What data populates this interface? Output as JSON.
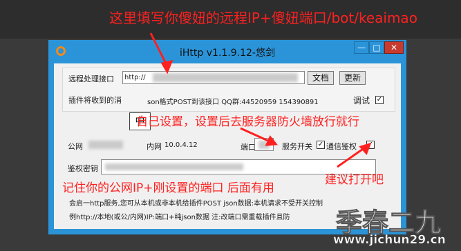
{
  "annotations": {
    "top": "这里填写你傻妞的远程IP+傻妞端口/bot/keaimao",
    "middle": "自己设置，设置后去服务器防火墙放行就行",
    "bottom": "记住你的公网IP+刚设置的端口 后面有用",
    "right": "建议打开吧"
  },
  "window": {
    "title": "iHttp v1.1.9.12-悠剑",
    "min_label": "—",
    "max_label": "□",
    "close_label": "✕"
  },
  "remote": {
    "label": "远程处理接口",
    "url_prefix": "http://",
    "doc_button": "文档",
    "update_button": "更新",
    "ime_char": "中",
    "info_suffix": "son格式POST到该接口 QQ群:44520959 154390891",
    "info_prefix": "插件将收到的消",
    "debug_label": "调试",
    "debug_checked": true
  },
  "network": {
    "public_label": "公网",
    "internal_label": "内网",
    "internal_ip": "10.0.4.12",
    "port_label": "端口",
    "service_switch_label": "服务开关",
    "service_checked": true,
    "auth_label": "通信鉴权",
    "auth_checked": true
  },
  "auth": {
    "key_label": "鉴权密钥"
  },
  "footer": {
    "line1": "会启一http服务,您可从本机或非本机给插件POST json数据:本机请求不受开关控制",
    "line2": "例http://本地(或公/内网)IP:端口+纯json数据 注:改端口需重载插件且防"
  },
  "watermark": {
    "text": "季春二九",
    "url": "www.jichun29.cn"
  }
}
